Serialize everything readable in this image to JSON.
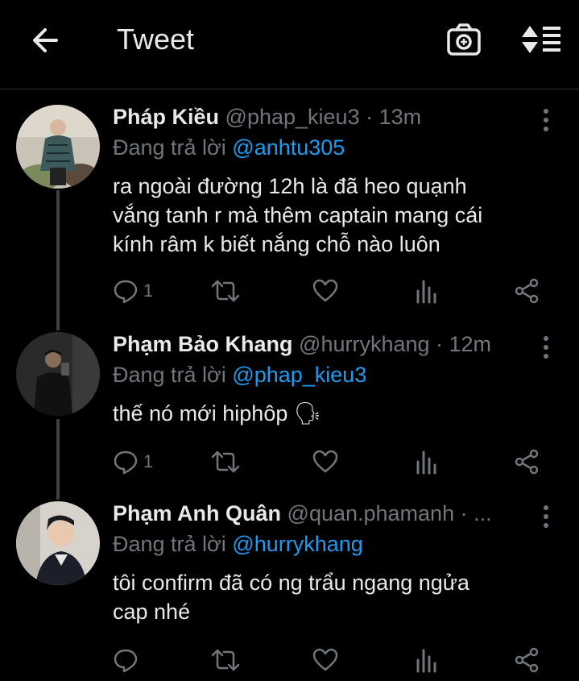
{
  "header": {
    "title": "Tweet"
  },
  "tweets": [
    {
      "name": "Pháp Kiều",
      "handle_time": "@phap_kieu3 · 13m",
      "reply_prefix": "Đang trả lời",
      "reply_to": "@anhtu305",
      "lines": [
        "ra ngoài đường 12h là đã heo quạnh",
        "vắng tanh r mà thêm captain mang cái",
        "kính râm k biết nắng chỗ nào luôn"
      ],
      "reply_count": "1"
    },
    {
      "name": "Phạm Bảo Khang",
      "handle_time": "@hurrykhang · 12m",
      "reply_prefix": "Đang trả lời",
      "reply_to": "@phap_kieu3",
      "lines": [
        "thế nó mới hiphôp 🗣"
      ],
      "reply_count": "1"
    },
    {
      "name": "Phạm Anh Quân",
      "handle_time": "@quan.phamanh · ...",
      "reply_prefix": "Đang trả lời",
      "reply_to": "@hurrykhang",
      "lines": [
        "tôi confirm đã có ng trẩu ngang ngửa",
        "cap nhé"
      ],
      "reply_count": ""
    }
  ],
  "icons": {
    "back": "arrow-left-icon",
    "camera": "camera-icon",
    "sort": "sort-icon",
    "reply": "reply-icon",
    "retweet": "retweet-icon",
    "like": "heart-icon",
    "analytics": "analytics-icon",
    "share": "share-icon",
    "more": "more-vertical-icon"
  },
  "colors": {
    "background": "#000000",
    "text": "#e7e9ea",
    "muted": "#71767b",
    "link": "#1d9bf0"
  }
}
